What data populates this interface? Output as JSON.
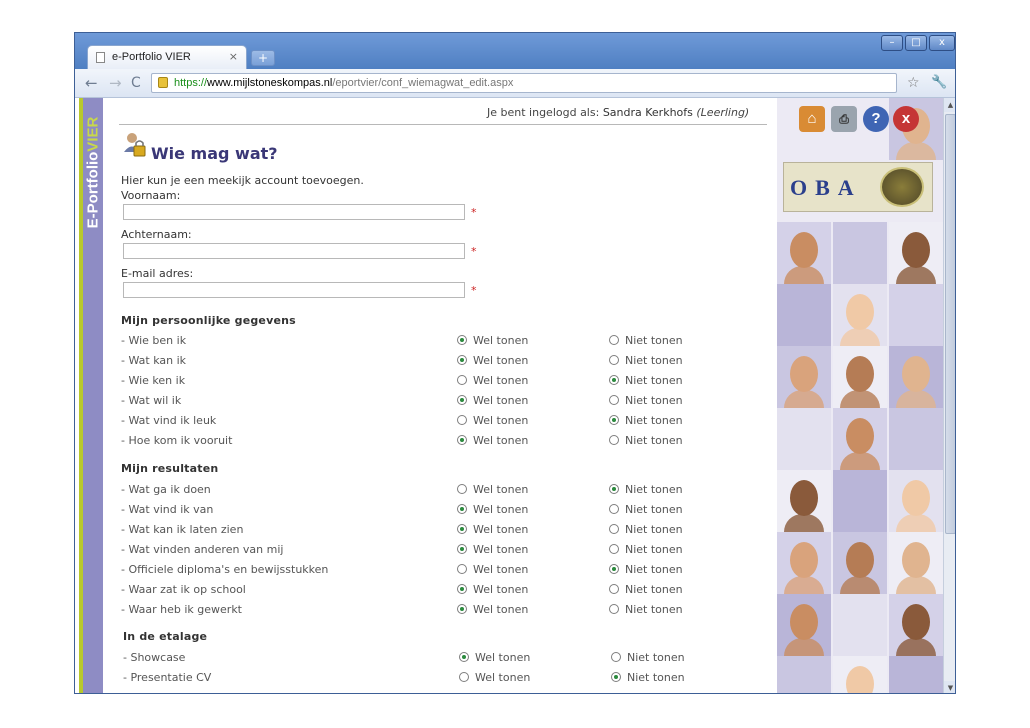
{
  "browser": {
    "tab_title": "e-Portfolio VIER",
    "tab_close": "×",
    "new_tab": "+",
    "url_scheme": "https://",
    "url_host": "www.mijlstoneskompas.nl",
    "url_path": "/eportvier/conf_wiemagwat_edit.aspx",
    "win_min": "–",
    "win_max": "□",
    "win_close": "x",
    "back": "←",
    "forward": "→",
    "reload": "C",
    "star": "☆",
    "wrench": "🔧"
  },
  "brand": {
    "part1": "E-Portfolio",
    "part2": "VIER"
  },
  "header": {
    "login_prefix": "Je bent ingelogd als:",
    "user_name": "Sandra Kerkhofs",
    "role": "(Leerling)"
  },
  "page": {
    "title": "Wie mag wat?",
    "intro": "Hier kun je een meekijk account toevoegen."
  },
  "form": {
    "fields": [
      {
        "label": "Voornaam:",
        "value": "",
        "required": "*"
      },
      {
        "label": "Achternaam:",
        "value": "",
        "required": "*"
      },
      {
        "label": "E-mail adres:",
        "value": "",
        "required": "*"
      }
    ],
    "option_show": "Wel tonen",
    "option_hide": "Niet tonen",
    "sections": [
      {
        "title": "Mijn persoonlijke gegevens",
        "rows": [
          {
            "label": "- Wie ben ik",
            "selected": "wel"
          },
          {
            "label": "- Wat kan ik",
            "selected": "wel"
          },
          {
            "label": "- Wie ken ik",
            "selected": "niet"
          },
          {
            "label": "- Wat wil ik",
            "selected": "wel"
          },
          {
            "label": "- Wat vind ik leuk",
            "selected": "niet"
          },
          {
            "label": "- Hoe kom ik vooruit",
            "selected": "wel"
          }
        ]
      },
      {
        "title": "Mijn resultaten",
        "rows": [
          {
            "label": "- Wat ga ik doen",
            "selected": "niet"
          },
          {
            "label": "- Wat vind ik van",
            "selected": "wel"
          },
          {
            "label": "- Wat kan ik laten zien",
            "selected": "wel"
          },
          {
            "label": "- Wat vinden anderen van mij",
            "selected": "wel"
          },
          {
            "label": "- Officiele diploma's en bewijsstukken",
            "selected": "niet"
          },
          {
            "label": "- Waar zat ik op school",
            "selected": "wel"
          },
          {
            "label": "- Waar heb ik gewerkt",
            "selected": "wel"
          }
        ]
      },
      {
        "title": "In de etalage",
        "rows": [
          {
            "label": "- Showcase",
            "selected": "wel"
          },
          {
            "label": "- Presentatie CV",
            "selected": "niet"
          }
        ]
      }
    ]
  },
  "sidebar": {
    "logo_text": "OBA",
    "help_glyph": "?",
    "exit_glyph": "x"
  }
}
